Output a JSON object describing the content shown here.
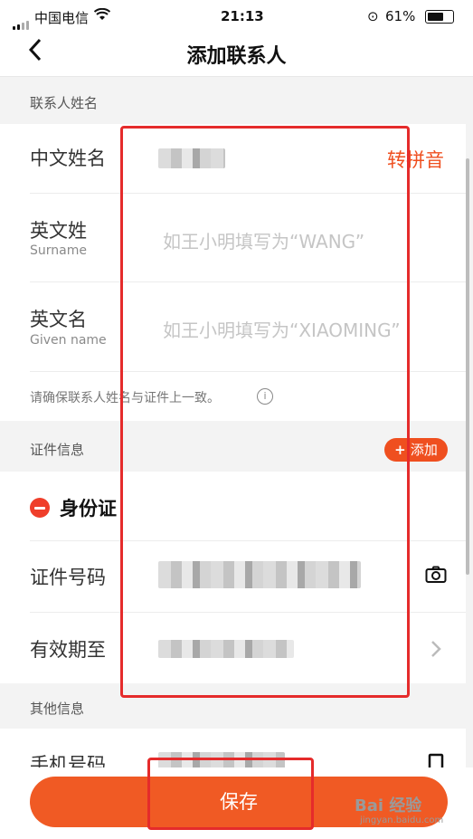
{
  "status_bar": {
    "carrier": "中国电信",
    "time": "21:13",
    "battery": "61%"
  },
  "header": {
    "title": "添加联系人"
  },
  "name_section": {
    "header": "联系人姓名",
    "chinese_name_label": "中文姓名",
    "pinyin_button": "转拼音",
    "surname_label": "英文姓",
    "surname_sub": "Surname",
    "surname_placeholder": "如王小明填写为“WANG”",
    "given_label": "英文名",
    "given_sub": "Given name",
    "given_placeholder": "如王小明填写为“XIAOMING”",
    "hint": "请确保联系人姓名与证件上一致。"
  },
  "id_section": {
    "header": "证件信息",
    "add_button": "添加",
    "doc_type": "身份证",
    "id_number_label": "证件号码",
    "expiry_label": "有效期至"
  },
  "other_section": {
    "header": "其他信息",
    "phone_label": "手机号码"
  },
  "save_button": "保存",
  "watermark": {
    "brand": "Bai 经验",
    "url": "jingyan.baidu.com"
  },
  "colors": {
    "accent": "#ef4f1f",
    "annotation": "#e52b2b"
  }
}
